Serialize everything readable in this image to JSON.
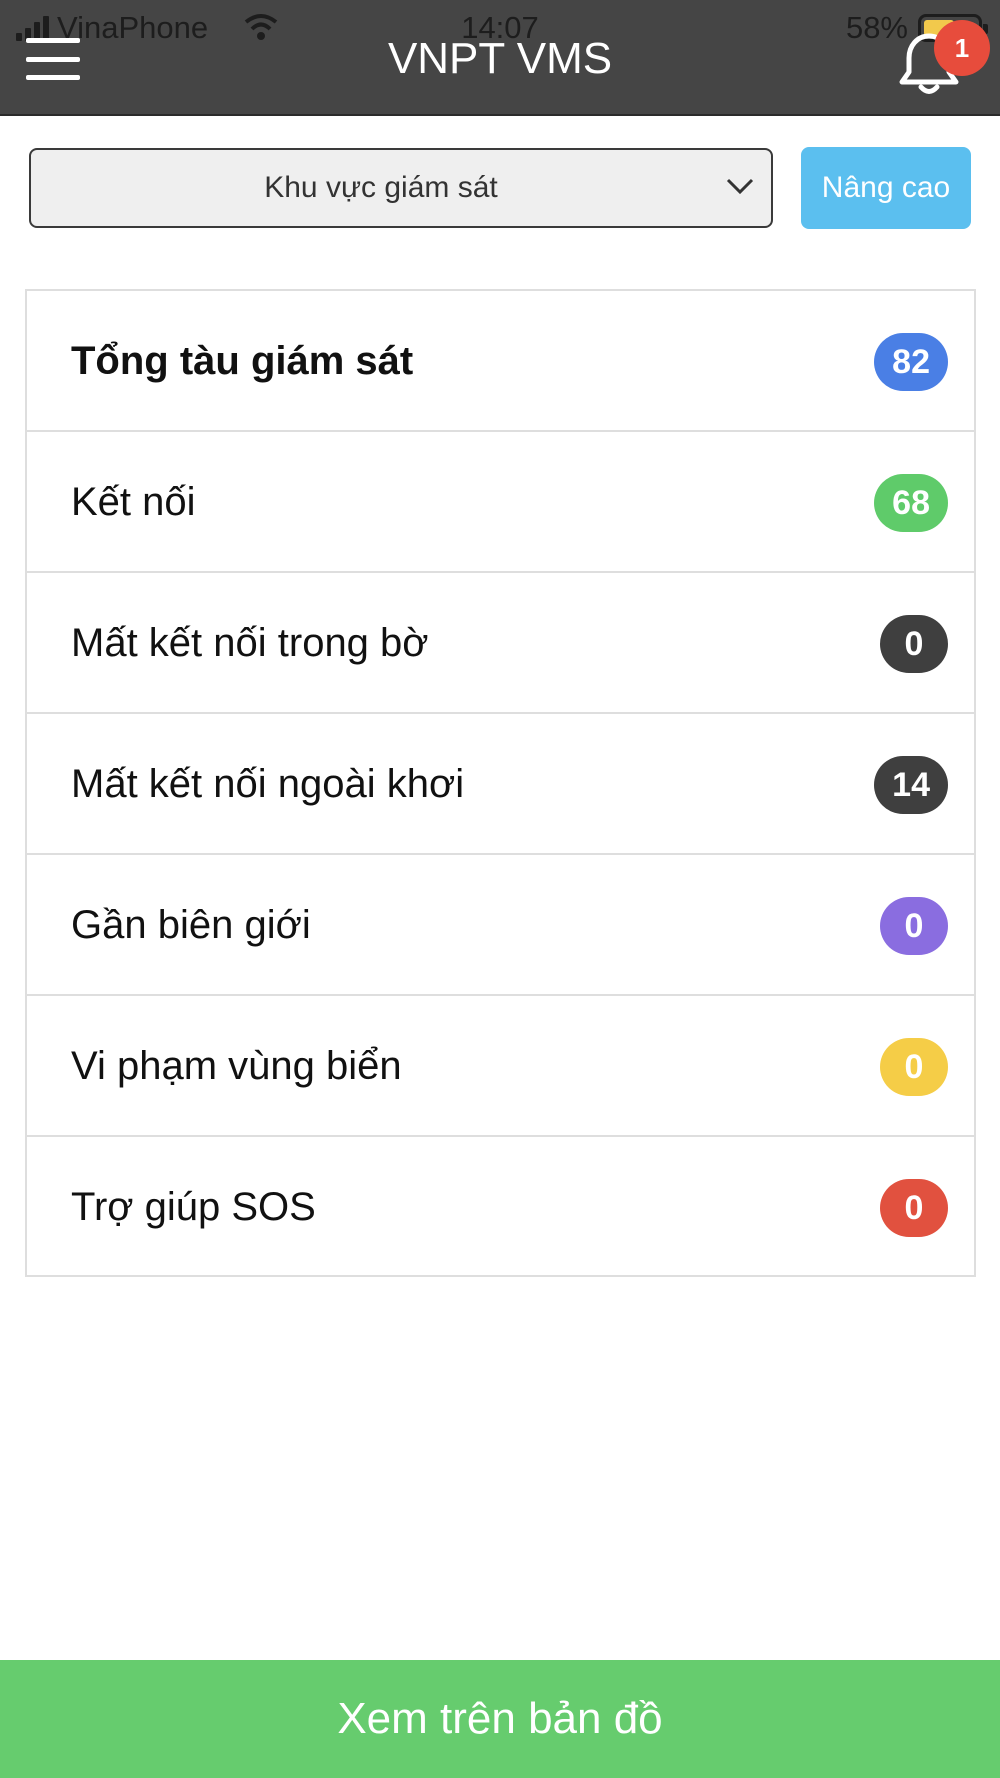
{
  "status_bar": {
    "carrier": "VinaPhone",
    "time": "14:07",
    "battery": "58%"
  },
  "header": {
    "title": "VNPT VMS",
    "notification_count": "1",
    "menu_icon": "hamburger-menu-icon",
    "bell_icon": "bell-icon"
  },
  "filters": {
    "area_select_value": "Khu vực giám sát",
    "advanced_label": "Nâng cao"
  },
  "stats": [
    {
      "label": "Tổng tàu giám sát",
      "count": "82",
      "color": "#4a7fe5"
    },
    {
      "label": "Kết nối",
      "count": "68",
      "color": "#5fcb6a"
    },
    {
      "label": "Mất kết nối trong bờ",
      "count": "0",
      "color": "#3f3f3f"
    },
    {
      "label": "Mất kết nối ngoài khơi",
      "count": "14",
      "color": "#3f3f3f"
    },
    {
      "label": "Gần biên giới",
      "count": "0",
      "color": "#8a6de0"
    },
    {
      "label": "Vi phạm vùng biển",
      "count": "0",
      "color": "#f5cd47"
    },
    {
      "label": "Trợ giúp SOS",
      "count": "0",
      "color": "#e1513f"
    }
  ],
  "footer": {
    "map_button_label": "Xem trên bản đồ"
  },
  "colors": {
    "header_bg": "#454545",
    "advanced_button": "#5bbfef",
    "map_button": "#66cc6e",
    "notification_badge": "#e74c3c"
  }
}
